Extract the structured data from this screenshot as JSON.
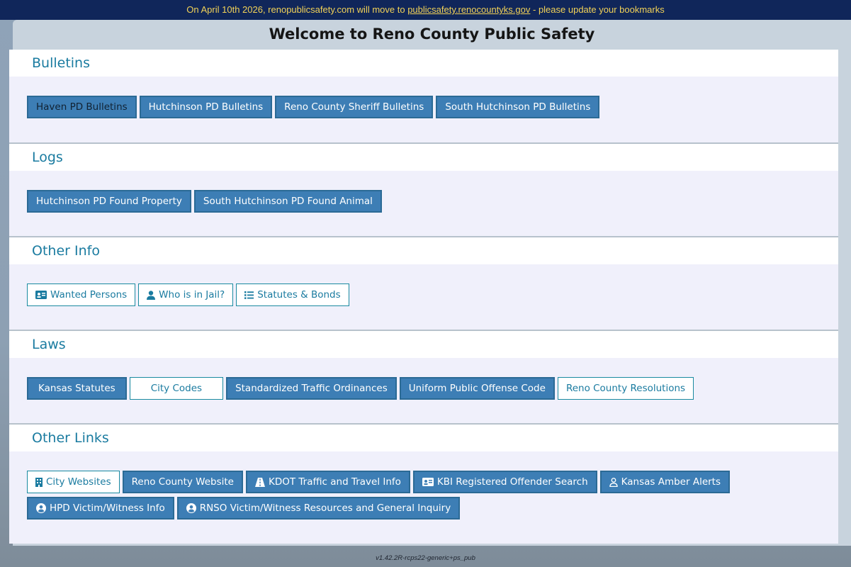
{
  "banner": {
    "prefix": "On April 10th 2026, renopublicsafety.com will move to ",
    "link": "publicsafety.renocountyks.gov",
    "suffix": " - please update your bookmarks"
  },
  "page_title": "Welcome to Reno County Public Safety",
  "sections": {
    "bulletins": {
      "title": "Bulletins",
      "buttons": [
        "Haven PD Bulletins",
        "Hutchinson PD Bulletins",
        "Reno County Sheriff Bulletins",
        "South Hutchinson PD Bulletins"
      ]
    },
    "logs": {
      "title": "Logs",
      "buttons": [
        "Hutchinson PD Found Property",
        "South Hutchinson PD Found Animal"
      ]
    },
    "other_info": {
      "title": "Other Info",
      "buttons": [
        {
          "label": "Wanted Persons",
          "icon": "id-card-icon"
        },
        {
          "label": "Who is in Jail?",
          "icon": "person-icon"
        },
        {
          "label": "Statutes & Bonds",
          "icon": "list-icon"
        }
      ]
    },
    "laws": {
      "title": "Laws",
      "buttons": [
        "Kansas Statutes",
        "City Codes",
        "Standardized Traffic Ordinances",
        "Uniform Public Offense Code",
        "Reno County Resolutions"
      ]
    },
    "other_links": {
      "title": "Other Links",
      "buttons": [
        {
          "label": "City Websites",
          "icon": "building-icon"
        },
        {
          "label": "Reno County Website"
        },
        {
          "label": "KDOT Traffic and Travel Info",
          "icon": "road-icon"
        },
        {
          "label": "KBI Registered Offender Search",
          "icon": "id-card-icon"
        },
        {
          "label": "Kansas Amber Alerts",
          "icon": "person-outline-icon"
        },
        {
          "label": "HPD Victim/Witness Info",
          "icon": "user-circle-icon"
        },
        {
          "label": "RNSO Victim/Witness Resources and General Inquiry",
          "icon": "user-circle-icon"
        }
      ]
    }
  },
  "version": "v1.42.2R-rcps22-generic+ps_pub",
  "colors": {
    "accent": "#3d7eb5",
    "banner_bg": "#10265a",
    "banner_text": "#f2d257",
    "heading": "#1a7ba0"
  }
}
